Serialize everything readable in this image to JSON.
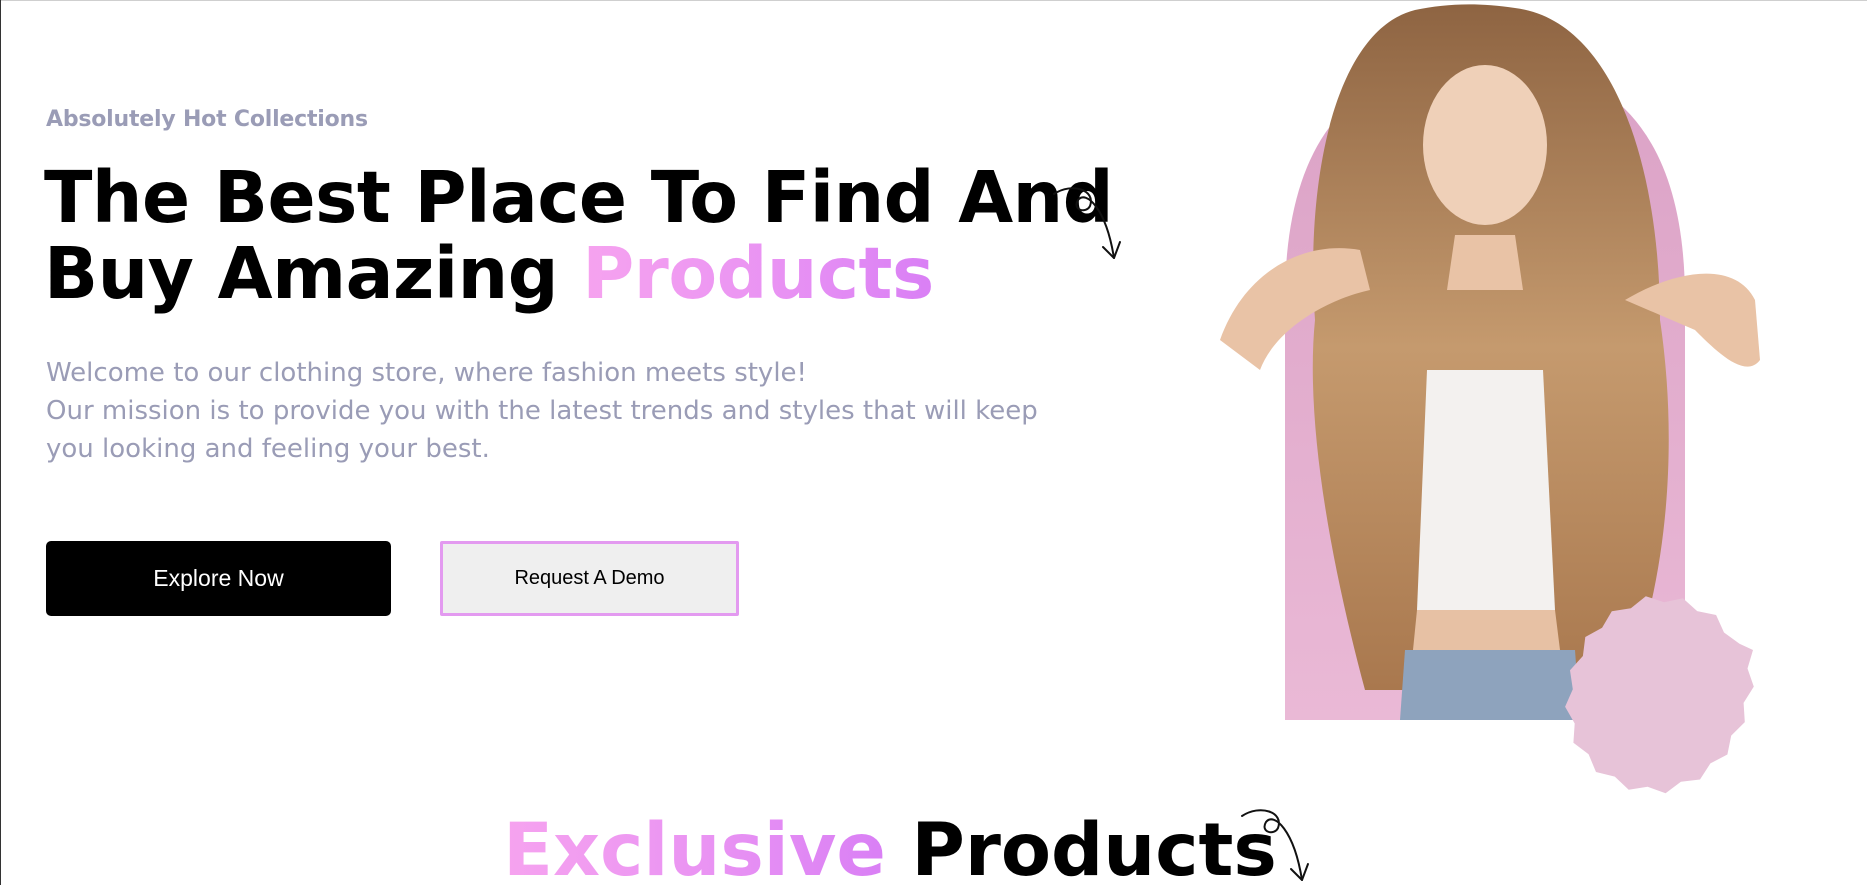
{
  "hero": {
    "eyebrow": "Absolutely Hot Collections",
    "headline_line1": "The Best Place To Find And",
    "headline_line2_prefix": "Buy Amazing ",
    "headline_line2_highlight": "Products",
    "intro_line1": "Welcome to our clothing store, where fashion meets style!",
    "intro_line2": "Our mission is to provide you with the latest trends and styles that will keep",
    "intro_line3": "you looking and feeling your best.",
    "explore_button": "Explore Now",
    "demo_button": "Request A Demo"
  },
  "section": {
    "title_highlight": "Exclusive",
    "title_rest": " Products"
  },
  "colors": {
    "accent_gradient_start": "#f6a3ef",
    "accent_gradient_end": "#d97ff5",
    "muted_text": "#9a9cb6",
    "arch_pink": "#e9b3d3",
    "badge_pink": "#e7c3d8"
  },
  "icons": [
    "curly-arrow-icon",
    "curly-arrow-icon"
  ]
}
